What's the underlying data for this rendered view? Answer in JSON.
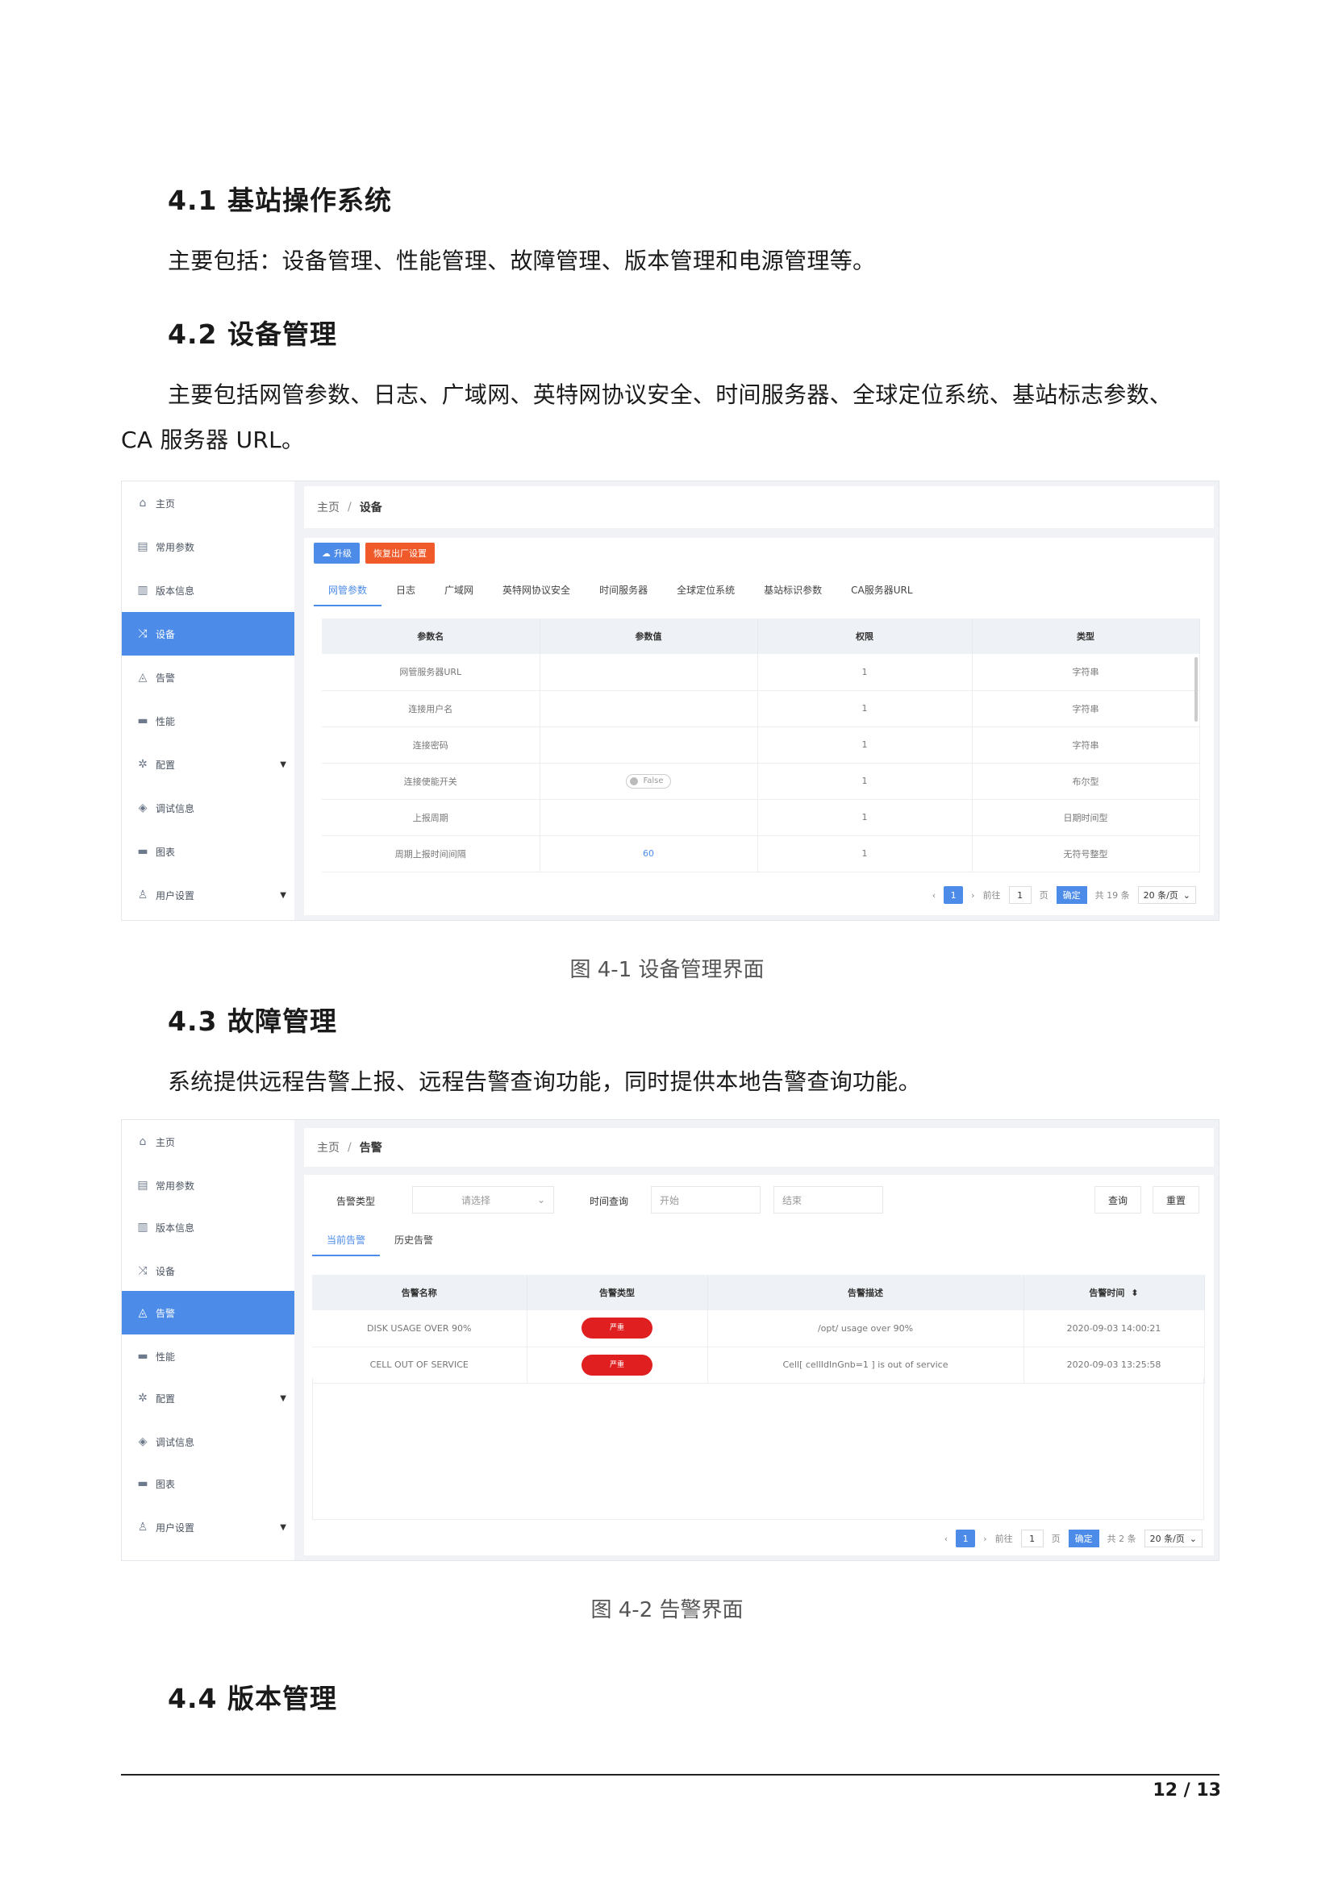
{
  "sections": {
    "s41_title": "4.1  基站操作系统",
    "s41_text": "主要包括：设备管理、性能管理、故障管理、版本管理和电源管理等。",
    "s42_title": "4.2  设备管理",
    "s42_text_line1": "主要包括网管参数、日志、广域网、英特网协议安全、时间服务器、全球定位系统、基站标志参数、",
    "s42_text_line2": "CA 服务器 URL。",
    "fig1_caption": "图 4-1  设备管理界面",
    "s43_title": "4.3  故障管理",
    "s43_text": "系统提供远程告警上报、远程告警查询功能，同时提供本地告警查询功能。",
    "fig2_caption": "图 4-2  告警界面",
    "s44_title": "4.4  版本管理"
  },
  "sidebar": {
    "items": [
      {
        "label": "主页",
        "icon": "home-icon",
        "glyph": "⌂"
      },
      {
        "label": "常用参数",
        "icon": "params-icon",
        "glyph": "▤"
      },
      {
        "label": "版本信息",
        "icon": "version-icon",
        "glyph": "▥"
      },
      {
        "label": "设备",
        "icon": "device-icon",
        "glyph": "⤨"
      },
      {
        "label": "告警",
        "icon": "bell-icon",
        "glyph": "◬"
      },
      {
        "label": "性能",
        "icon": "monitor-icon",
        "glyph": "▬"
      },
      {
        "label": "配置",
        "icon": "gear-icon",
        "glyph": "✲"
      },
      {
        "label": "调试信息",
        "icon": "layers-icon",
        "glyph": "◈"
      },
      {
        "label": "图表",
        "icon": "chart-icon",
        "glyph": "▬"
      },
      {
        "label": "用户设置",
        "icon": "user-icon",
        "glyph": "♙"
      }
    ]
  },
  "shot1": {
    "breadcrumb_home": "主页",
    "breadcrumb_sep": "/",
    "breadcrumb_current": "设备",
    "upgrade_button": "升级",
    "reset_button": "恢复出厂设置",
    "tabs": [
      "网管参数",
      "日志",
      "广域网",
      "英特网协议安全",
      "时间服务器",
      "全球定位系统",
      "基站标识参数",
      "CA服务器URL"
    ],
    "columns": [
      "参数名",
      "参数值",
      "权限",
      "类型"
    ],
    "rows": [
      [
        "网管服务器URL",
        "",
        "1",
        "字符串"
      ],
      [
        "连接用户名",
        "",
        "1",
        "字符串"
      ],
      [
        "连接密码",
        "",
        "1",
        "字符串"
      ],
      [
        "连接使能开关",
        "False",
        "1",
        "布尔型"
      ],
      [
        "上报周期",
        "",
        "1",
        "日期时间型"
      ],
      [
        "周期上报时间间隔",
        "60",
        "1",
        "无符号整型"
      ]
    ],
    "pagination": {
      "prev": "‹",
      "current": "1",
      "next": "›",
      "goto": "前往",
      "page": "1",
      "page_unit": "页",
      "confirm": "确定",
      "total": "共 19 条",
      "per_page": "20 条/页"
    }
  },
  "shot2": {
    "breadcrumb_home": "主页",
    "breadcrumb_sep": "/",
    "breadcrumb_current": "告警",
    "filter_type_label": "告警类型",
    "filter_type_placeholder": "请选择",
    "filter_time_label": "时间查询",
    "filter_start_placeholder": "开始",
    "filter_end_placeholder": "结束",
    "query_button": "查询",
    "reset_button": "重置",
    "tabs": [
      "当前告警",
      "历史告警"
    ],
    "columns": [
      "告警名称",
      "告警类型",
      "告警描述",
      "告警时间"
    ],
    "rows": [
      [
        "DISK USAGE OVER 90%",
        "严重",
        "/opt/ usage over 90%",
        "2020-09-03 14:00:21"
      ],
      [
        "CELL OUT OF SERVICE",
        "严重",
        "Cell[ cellIdInGnb=1 ] is out of service",
        "2020-09-03 13:25:58"
      ]
    ],
    "pagination": {
      "prev": "‹",
      "current": "1",
      "next": "›",
      "goto": "前往",
      "page": "1",
      "page_unit": "页",
      "confirm": "确定",
      "total": "共 2 条",
      "per_page": "20 条/页"
    }
  },
  "page_number": "12 / 13",
  "colors": {
    "accent": "#4c8be8",
    "danger": "#e02020",
    "reset": "#f05a2a"
  }
}
